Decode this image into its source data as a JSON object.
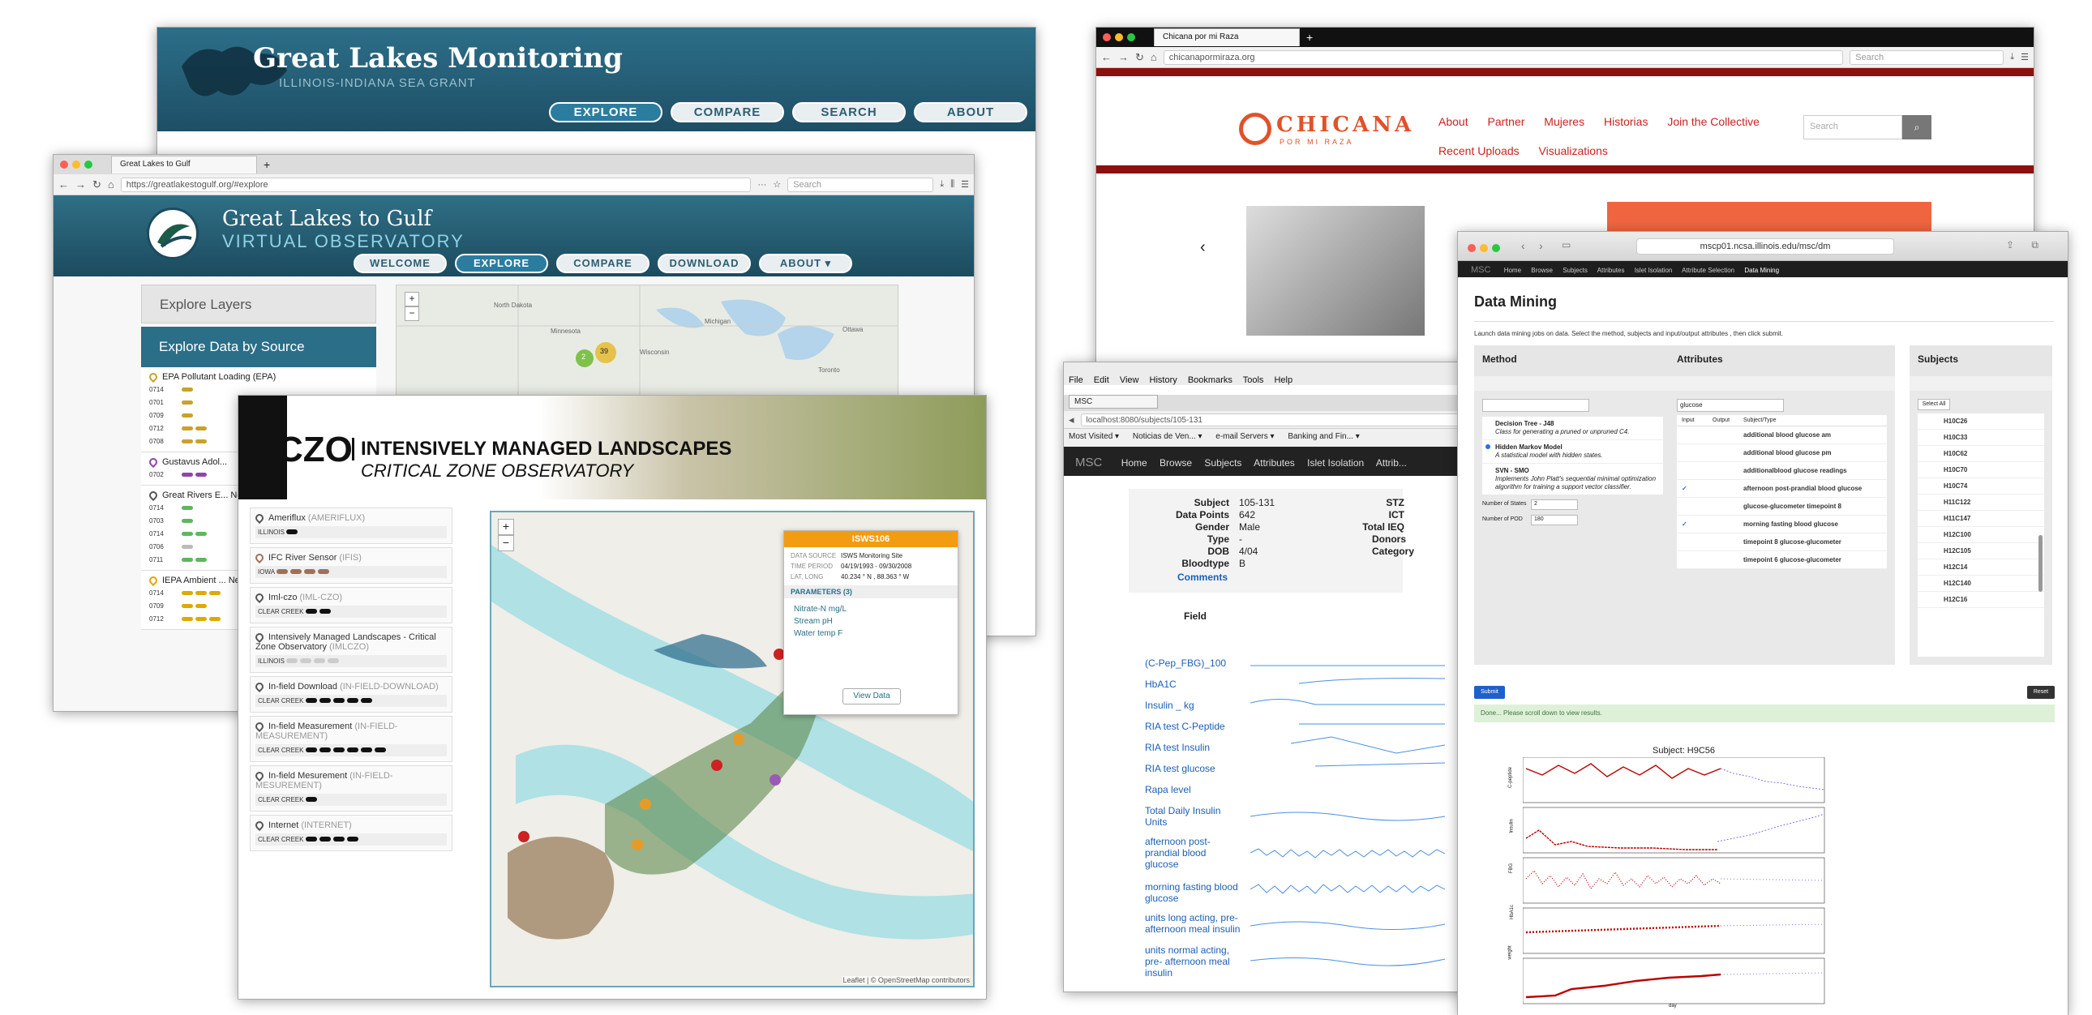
{
  "glm": {
    "title": "Great Lakes Monitoring",
    "subtitle": "ILLINOIS-INDIANA SEA GRANT",
    "nav": [
      "EXPLORE",
      "COMPARE",
      "SEARCH",
      "ABOUT"
    ]
  },
  "glg": {
    "tab_title": "Great Lakes to Gulf",
    "url": "https://greatlakestogulf.org/#explore",
    "search_placeholder": "Search",
    "title": "Great Lakes to Gulf",
    "subtitle": "VIRTUAL OBSERVATORY",
    "nav": [
      "WELCOME",
      "EXPLORE",
      "COMPARE",
      "DOWNLOAD",
      "ABOUT ▾"
    ],
    "sidebar": {
      "layers_label": "Explore Layers",
      "data_source_label": "Explore Data by Source"
    },
    "sources": [
      {
        "name": "EPA Pollutant Loading (EPA)",
        "color": "#c9a227",
        "rows": [
          "0714",
          "0701",
          "0709",
          "0712",
          "0708"
        ]
      },
      {
        "name": "Gustavus Adol...",
        "color": "#8e44ad",
        "rows": [
          "0702"
        ]
      },
      {
        "name": "Great Rivers E... Network (GRE...",
        "color": "#5cb85c",
        "rows": [
          "0714",
          "0703",
          "0714",
          "0706",
          "0711"
        ]
      },
      {
        "name": "IEPA Ambient ... Network (IEPA...",
        "color": "#e0a800",
        "rows": [
          "0714",
          "0709",
          "0712"
        ]
      }
    ],
    "map_cluster_labels": [
      "2",
      "39"
    ],
    "map_places": [
      "North Dakota",
      "Minnesota",
      "Wisconsin",
      "Michigan",
      "Ottawa",
      "Toronto"
    ]
  },
  "czo": {
    "title_main": "INTENSIVELY MANAGED LANDSCAPES",
    "title_sub": "CRITICAL ZONE OBSERVATORY",
    "logo_text": "CZO",
    "items": [
      {
        "name": "Ameriflux",
        "code": "(AMERIFLUX)",
        "site": "ILLINOIS"
      },
      {
        "name": "IFC River Sensor",
        "code": "(IFIS)",
        "site": "IOWA"
      },
      {
        "name": "Iml-czo",
        "code": "(IML-CZO)",
        "site": "CLEAR CREEK"
      },
      {
        "name": "Intensively Managed Landscapes - Critical Zone Observatory",
        "code": "(IMLCZO)",
        "site": "ILLINOIS"
      },
      {
        "name": "In-field Download",
        "code": "(IN-FIELD-DOWNLOAD)",
        "site": "CLEAR CREEK"
      },
      {
        "name": "In-field Measurement",
        "code": "(IN-FIELD-MEASUREMENT)",
        "site": "CLEAR CREEK"
      },
      {
        "name": "In-field Mesurement",
        "code": "(IN-FIELD-MESUREMENT)",
        "site": "CLEAR CREEK"
      },
      {
        "name": "Internet",
        "code": "(INTERNET)",
        "site": "CLEAR CREEK"
      }
    ],
    "popup": {
      "title": "ISWS106",
      "data_source_label": "DATA SOURCE",
      "data_source": "ISWS Monitoring Site",
      "time_period_label": "TIME PERIOD",
      "time_period": "04/19/1993 - 09/30/2008",
      "latlong_label": "LAT, LONG",
      "latlong": "40.234 ° N , 88.363 ° W",
      "params_label": "PARAMETERS",
      "params_count": "(3)",
      "params": [
        "Nitrate-N mg/L",
        "Stream pH",
        "Water temp F"
      ],
      "view_button": "View Data"
    },
    "attribution": "Leaflet | © OpenStreetMap contributors"
  },
  "chicana": {
    "tab_title": "Chicana por mi Raza",
    "url": "chicanapormiraza.org",
    "search_placeholder": "Search",
    "logo_main": "CHICANA",
    "logo_sub": "POR MI RAZA",
    "nav": [
      "About",
      "Partner",
      "Mujeres",
      "Historias",
      "Join the Collective",
      "Recent Uploads",
      "Visualizations"
    ],
    "site_search_placeholder": "Search"
  },
  "msc_local": {
    "menu": [
      "File",
      "Edit",
      "View",
      "History",
      "Bookmarks",
      "Tools",
      "Help"
    ],
    "tab_title": "MSC",
    "url": "localhost:8080/subjects/105-131",
    "bookmarks": [
      "Most Visited ▾",
      "Noticias de Ven... ▾",
      "e-mail Servers ▾",
      "Banking and Fin... ▾"
    ],
    "brand": "MSC",
    "nav": [
      "Home",
      "Browse",
      "Subjects",
      "Attributes",
      "Islet Isolation",
      "Attrib..."
    ],
    "subject_fields": [
      {
        "label": "Subject",
        "value": "105-131"
      },
      {
        "label": "Data Points",
        "value": "642"
      },
      {
        "label": "Gender",
        "value": "Male"
      },
      {
        "label": "Type",
        "value": "-"
      },
      {
        "label": "DOB",
        "value": "4/04"
      },
      {
        "label": "Bloodtype",
        "value": "B"
      }
    ],
    "right_labels": [
      "STZ",
      "ICT",
      "Total IEQ",
      "Donors",
      "Category"
    ],
    "comments_label": "Comments",
    "field_header": "Field",
    "fields": [
      "(C-Pep_FBG)_100",
      "HbA1C",
      "Insulin _ kg",
      "RIA test C-Peptide",
      "RIA test Insulin",
      "RIA test glucose",
      "Rapa level",
      "Total Daily Insulin Units",
      "afternoon post-prandial blood glucose",
      "morning fasting blood glucose",
      "units long acting, pre-afternoon meal insulin",
      "units normal acting, pre- afternoon meal insulin"
    ]
  },
  "msc_dm": {
    "url": "mscp01.ncsa.illinois.edu/msc/dm",
    "nav": [
      "MSC",
      "Home",
      "Browse",
      "Subjects",
      "Attributes",
      "Islet Isolation",
      "Attribute Selection",
      "Data Mining"
    ],
    "title": "Data Mining",
    "intro": "Launch data mining jobs on data. Select the method, subjects and input/output attributes , then click submit.",
    "method_header": "Method",
    "attributes_header": "Attributes",
    "subjects_header": "Subjects",
    "methods": [
      {
        "name": "Decision Tree - J48",
        "desc": "Class for generating a pruned or unpruned C4."
      },
      {
        "name": "Hidden Markov Model",
        "desc": "A statistical model with hidden states."
      },
      {
        "name": "SVN - SMO",
        "desc": "Implements John Platt's sequential minimal optimization algorithm for training a support vector classifier."
      }
    ],
    "num_states_label": "Number of States",
    "num_states": "2",
    "num_pod_label": "Number of POD",
    "num_pod": "180",
    "attr_search": "glucose",
    "attr_cols": [
      "Input",
      "Output",
      "Subject/Type"
    ],
    "attributes": [
      "additional blood glucose am",
      "additional blood glucose pm",
      "additionalblood glucose readings",
      "afternoon post-prandial blood glucose",
      "glucose-glucometer timepoint 8",
      "morning fasting blood glucose",
      "timepoint 8 glucose-glucometer",
      "timepoint 6 glucose-glucometer"
    ],
    "select_all": "Select All",
    "subjects": [
      "H10C26",
      "H10C33",
      "H10C62",
      "H10C70",
      "H10C74",
      "H11C122",
      "H11C147",
      "H12C100",
      "H12C105",
      "H12C14",
      "H12C140",
      "H12C16"
    ],
    "submit": "Submit",
    "reset": "Reset",
    "done_msg": "Done... Please scroll down to view results.",
    "chart_title": "Subject: H9C56",
    "chart_ylabels": [
      "C-peptide",
      "Insulin",
      "FBG",
      "HbA1c",
      "weight"
    ],
    "chart_xlabel": "day"
  }
}
